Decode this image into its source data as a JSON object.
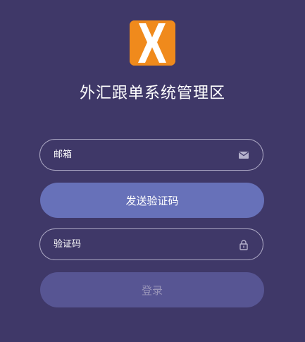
{
  "logo": {
    "icon": "x-logo-icon",
    "background": "#f08a1c"
  },
  "page": {
    "title": "外汇跟单系统管理区"
  },
  "form": {
    "email": {
      "placeholder": "邮箱",
      "value": "",
      "icon": "envelope-icon"
    },
    "send_code_label": "发送验证码",
    "code": {
      "placeholder": "验证码",
      "value": "",
      "icon": "lock-icon"
    },
    "login_label": "登录"
  },
  "colors": {
    "background": "#3f3868",
    "accent_button": "#6771b9",
    "disabled_button": "#575593"
  }
}
